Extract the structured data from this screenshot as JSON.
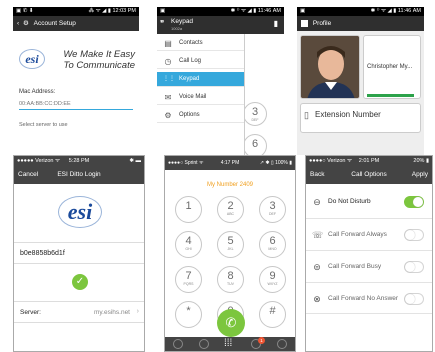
{
  "screen1": {
    "status_right": "⁂ ᯤ ◢ ▮ 12:03 PM",
    "title": "Account Setup",
    "tagline1": "We Make It Easy",
    "tagline2": "To Communicate",
    "logo_text": "esi",
    "mac_label": "Mac Address:",
    "mac_placeholder": "00:AA:BB:CC:DD:EE",
    "partial_text": "Select server to use"
  },
  "screen2": {
    "status_right": "✱ ⁽⁾ ᯤ ◢ ▮ 11:46 AM",
    "title": "Keypad",
    "subtitle": "1002a",
    "menu": [
      {
        "label": "Contacts",
        "icon": "contacts-icon",
        "glyph": "▤"
      },
      {
        "label": "Call Log",
        "icon": "clock-icon",
        "glyph": "◷"
      },
      {
        "label": "Keypad",
        "icon": "keypad-icon",
        "glyph": "⋮⋮",
        "active": true
      },
      {
        "label": "Voice Mail",
        "icon": "mail-icon",
        "glyph": "✉"
      },
      {
        "label": "Options",
        "icon": "gear-icon",
        "glyph": "⚙"
      }
    ],
    "key3_digit": "3",
    "key3_sub": "DEF",
    "key6_digit": "6"
  },
  "screen3": {
    "status_right": "✱ ⁽⁾ ᯤ ◢ ▮ 11:46 AM",
    "title": "Profile",
    "name": "Christopher My...",
    "extension_label": "Extension Number"
  },
  "screen4": {
    "carrier": "●●●●● Verizon ᯤ",
    "time": "5:28 PM",
    "cancel": "Cancel",
    "title": "ESI Ditto Login",
    "logo_text": "esi",
    "user_value": "b0e8858b6d1f",
    "server_label": "Server:",
    "server_value": "my.esihs.net"
  },
  "screen5": {
    "carrier": "●●●●○ Sprint ᯤ",
    "time": "4:17 PM",
    "status_right": "↗ ✱ ▯ 100% ▮",
    "my_number": "My Number 2409",
    "keys": [
      {
        "d": "1",
        "s": ""
      },
      {
        "d": "2",
        "s": "ABC"
      },
      {
        "d": "3",
        "s": "DEF"
      },
      {
        "d": "4",
        "s": "GHI"
      },
      {
        "d": "5",
        "s": "JKL"
      },
      {
        "d": "6",
        "s": "MNO"
      },
      {
        "d": "7",
        "s": "PQRS"
      },
      {
        "d": "8",
        "s": "TUV"
      },
      {
        "d": "9",
        "s": "WXYZ"
      },
      {
        "d": "*",
        "s": ""
      },
      {
        "d": "0",
        "s": "+"
      },
      {
        "d": "#",
        "s": ""
      }
    ],
    "badge_count": "1"
  },
  "screen6": {
    "carrier": "●●●●○ Verizon ᯤ",
    "time": "2:01 PM",
    "battery": "20% ▮",
    "back": "Back",
    "title": "Call Options",
    "apply": "Apply",
    "options": [
      {
        "label": "Do Not Disturb",
        "icon": "minus-circle-icon",
        "glyph": "⊖",
        "on": true
      },
      {
        "label": "Call Forward Always",
        "icon": "phone-forward-icon",
        "glyph": "☏",
        "on": false
      },
      {
        "label": "Call Forward Busy",
        "icon": "busy-forward-icon",
        "glyph": "⊜",
        "on": false
      },
      {
        "label": "Call Forward No Answer",
        "icon": "no-answer-icon",
        "glyph": "⊗",
        "on": false
      }
    ]
  },
  "colors": {
    "accent_green": "#7cc63e",
    "menu_highlight": "#35a8dc",
    "keypad_orange": "#f0a020",
    "esi_blue": "#1b4a9b"
  }
}
